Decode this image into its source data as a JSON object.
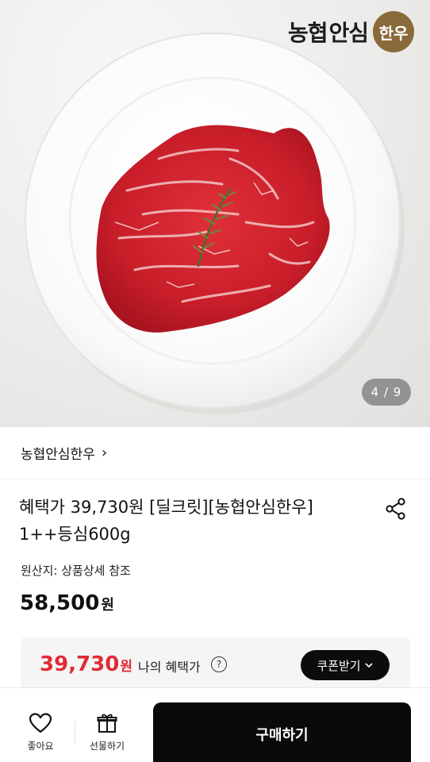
{
  "hero": {
    "logo": {
      "part1": "농협",
      "part2": "안심",
      "seal": "한우"
    },
    "counter": "4 / 9"
  },
  "brand_row": {
    "label": "농협안심한우",
    "chevron": "›"
  },
  "product": {
    "title": "혜택가 39,730원 [딜크릿][농협안심한우] 1++등심600g",
    "origin": "원산지: 상품상세 참조",
    "price": "58,500",
    "price_unit": "원"
  },
  "benefit": {
    "price": "39,730",
    "price_unit": "원",
    "label": "나의 혜택가",
    "help": "?",
    "coupon_label": "쿠폰받기",
    "coupon_chevron": "⌄"
  },
  "bottom_bar": {
    "like_label": "좋아요",
    "gift_label": "선물하기",
    "buy_label": "구매하기"
  },
  "colors": {
    "accent_red": "#e02c36",
    "button_black": "#0a0a0a",
    "benefit_bg": "#f5f5f5"
  }
}
